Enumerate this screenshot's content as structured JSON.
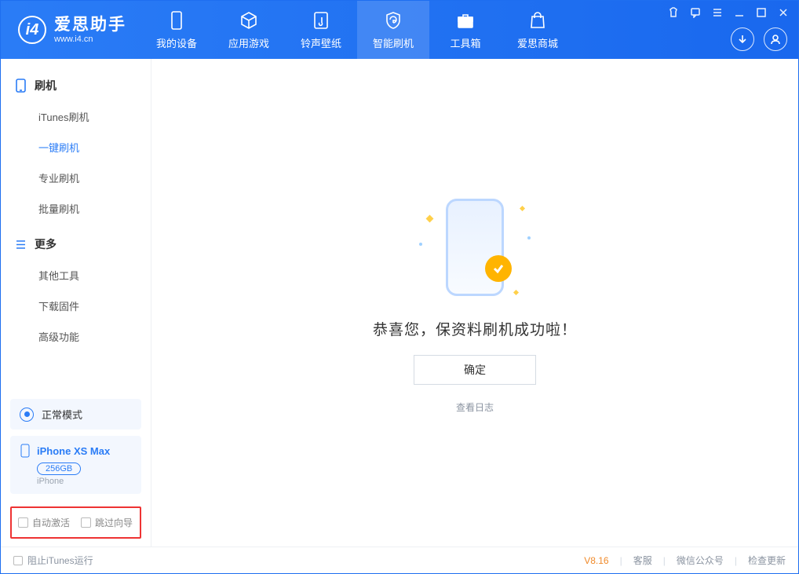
{
  "app": {
    "name": "爱思助手",
    "url": "www.i4.cn"
  },
  "nav": {
    "items": [
      {
        "label": "我的设备"
      },
      {
        "label": "应用游戏"
      },
      {
        "label": "铃声壁纸"
      },
      {
        "label": "智能刷机"
      },
      {
        "label": "工具箱"
      },
      {
        "label": "爱思商城"
      }
    ],
    "active_index": 3
  },
  "sidebar": {
    "groups": [
      {
        "title": "刷机",
        "items": [
          "iTunes刷机",
          "一键刷机",
          "专业刷机",
          "批量刷机"
        ],
        "active_index": 1
      },
      {
        "title": "更多",
        "items": [
          "其他工具",
          "下载固件",
          "高级功能"
        ],
        "active_index": -1
      }
    ],
    "status": {
      "label": "正常模式"
    },
    "device": {
      "name": "iPhone XS Max",
      "storage": "256GB",
      "type": "iPhone"
    },
    "options": {
      "auto_activate": "自动激活",
      "skip_guide": "跳过向导"
    }
  },
  "main": {
    "success_text": "恭喜您，保资料刷机成功啦！",
    "ok_label": "确定",
    "log_link": "查看日志"
  },
  "footer": {
    "block_itunes": "阻止iTunes运行",
    "version": "V8.16",
    "links": [
      "客服",
      "微信公众号",
      "检查更新"
    ]
  }
}
